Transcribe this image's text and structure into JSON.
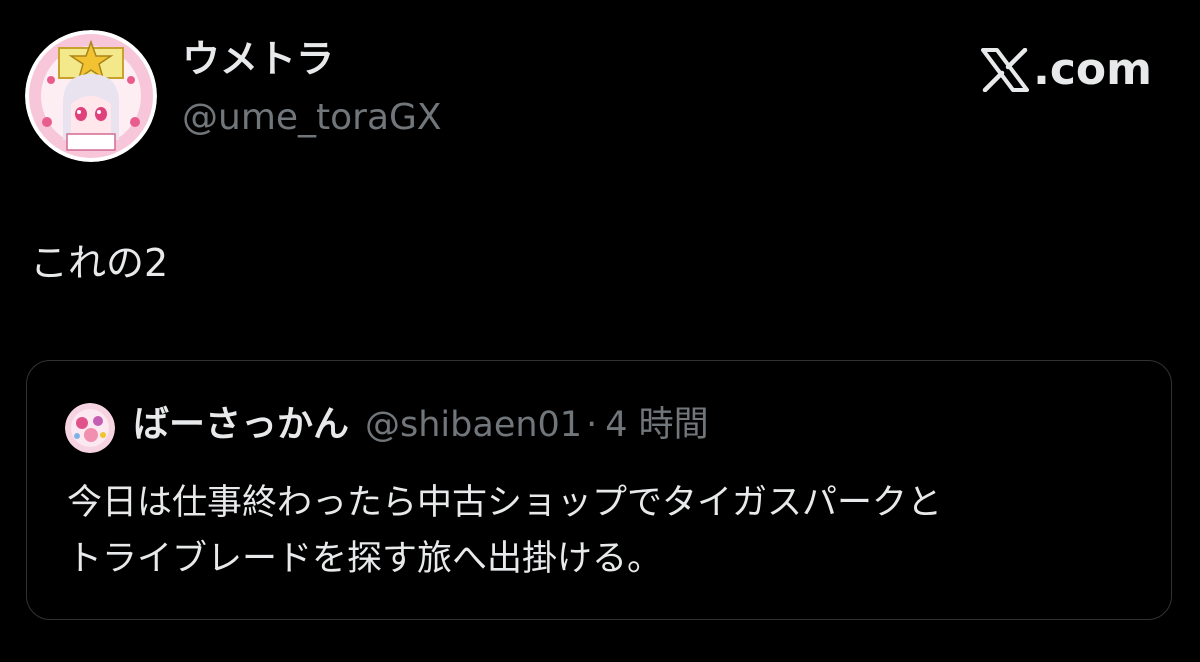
{
  "tweet": {
    "author": {
      "display_name": "ウメトラ",
      "handle": "@ume_toraGX",
      "avatar_icon": "profile-avatar-anime-character"
    },
    "text": "これの2"
  },
  "brand": {
    "label": ".com",
    "icon": "x-logo-icon"
  },
  "quoted_tweet": {
    "author": {
      "display_name": "ばーさっかん",
      "handle": "@shibaen01",
      "avatar_icon": "profile-avatar-pink"
    },
    "separator": "·",
    "time": "4 時間",
    "lines": [
      "今日は仕事終わったら中古ショップでタイガスパークと",
      "トライブレードを探す旅へ出掛ける。"
    ]
  },
  "colors": {
    "background": "#000000",
    "primary_text": "#e7e9ea",
    "secondary_text": "#71767b",
    "card_border": "#2f3336"
  }
}
